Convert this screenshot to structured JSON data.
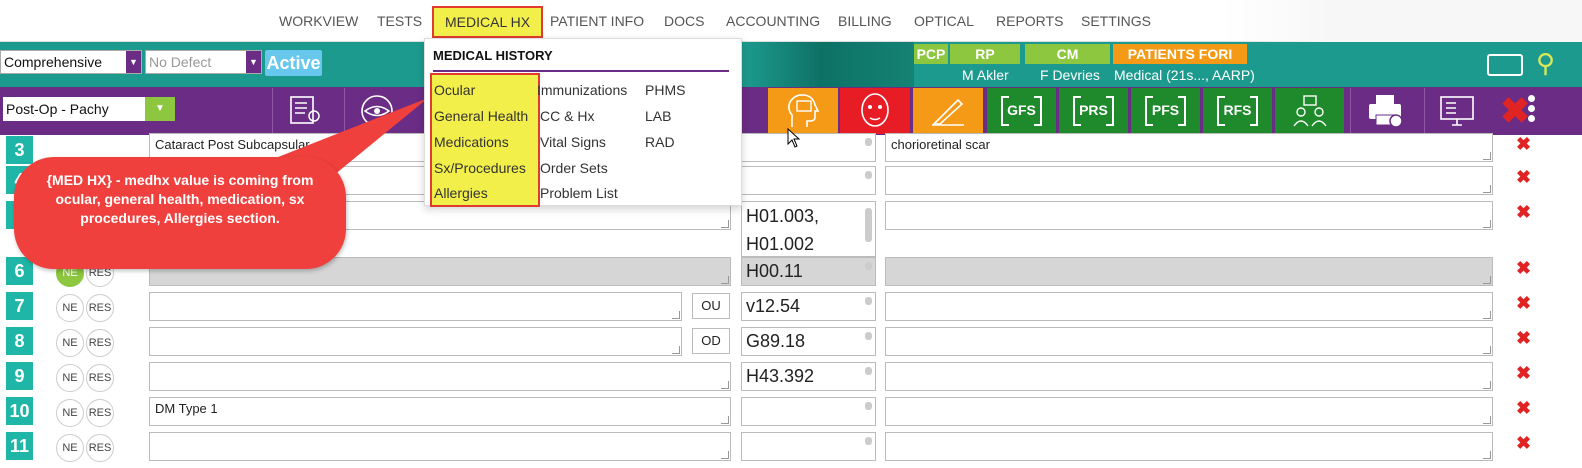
{
  "nav": {
    "items": [
      "WORKVIEW",
      "TESTS",
      "MEDICAL HX",
      "PATIENT INFO",
      "DOCS",
      "ACCOUNTING",
      "BILLING",
      "OPTICAL",
      "REPORTS",
      "SETTINGS"
    ],
    "active": "MEDICAL HX"
  },
  "header": {
    "exam_type": "Comprehensive",
    "defect": "No Defect",
    "status": "Active",
    "tabs": [
      "PCP",
      "RP",
      "CM",
      "PATIENTS FORI"
    ],
    "pcp_name": "M Akler",
    "rp_name": "F Devries",
    "insurance": "Medical (21s..., AARP)"
  },
  "toolbar": {
    "visit_type": "Post-Op - Pachy",
    "forms": [
      "GFS",
      "PRS",
      "PFS",
      "RFS"
    ],
    "colors": {
      "orange": "#f59a17",
      "red": "#e81c24",
      "green": "#1e8a2b",
      "purple": "#6a2c84"
    }
  },
  "menu": {
    "title": "MEDICAL HISTORY",
    "col1": [
      "Ocular",
      "General Health",
      "Medications",
      "Sx/Procedures",
      "Allergies"
    ],
    "col2": [
      "Immunizations",
      "CC & Hx",
      "Vital Signs",
      "Order Sets",
      "Problem List"
    ],
    "col3": [
      "PHMS",
      "LAB",
      "RAD"
    ]
  },
  "callout": {
    "text": "{MED HX} - medhx value is coming from ocular, general health, medication, sx procedures, Allergies section."
  },
  "rows": [
    {
      "num": "3",
      "desc": "Cataract Post Subcapsular",
      "eye": "",
      "code": "",
      "note": "chorioretinal scar"
    },
    {
      "num": "4",
      "desc": "",
      "eye": "",
      "code": "",
      "note": ""
    },
    {
      "num": "5",
      "desc": "",
      "eye": "",
      "code": "H01.003,\nH01.002",
      "note": ""
    },
    {
      "num": "6",
      "desc": "",
      "eye": "",
      "code": "H00.11",
      "note": ""
    },
    {
      "num": "7",
      "desc": "",
      "eye": "OU",
      "code": "v12.54",
      "note": ""
    },
    {
      "num": "8",
      "desc": "",
      "eye": "OD",
      "code": "G89.18",
      "note": ""
    },
    {
      "num": "9",
      "desc": "",
      "eye": "",
      "code": "H43.392",
      "note": ""
    },
    {
      "num": "10",
      "desc": "DM Type 1",
      "eye": "",
      "code": "",
      "note": ""
    },
    {
      "num": "11",
      "desc": "",
      "eye": "",
      "code": "",
      "note": ""
    }
  ],
  "row_labels": {
    "ne": "NE",
    "res": "RES"
  }
}
